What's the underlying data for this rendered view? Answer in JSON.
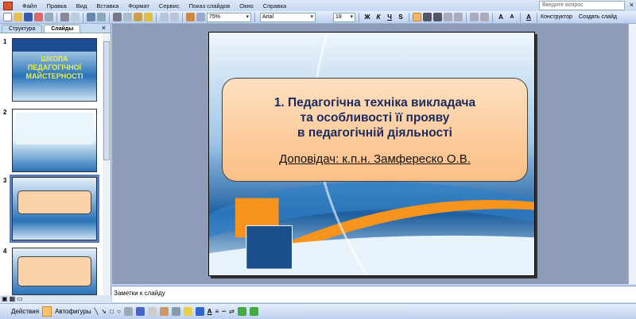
{
  "menu": [
    "Файл",
    "Правка",
    "Вид",
    "Вставка",
    "Формат",
    "Сервис",
    "Показ слайдов",
    "Окно",
    "Справка"
  ],
  "help_placeholder": "Введите вопрос",
  "toolbar": {
    "zoom": "75%",
    "font": "Arial",
    "size": "18",
    "bold": "Ж",
    "italic": "К",
    "underline": "Ч",
    "shadow": "S",
    "designer": "Конструктор",
    "new_slide": "Создать слайд"
  },
  "pane": {
    "tabs": [
      "Структура",
      "Слайды"
    ],
    "close": "×"
  },
  "thumbs": [
    {
      "num": "1",
      "title": "ШКОЛА ПЕДАГОГІЧНОЇ МАЙСТЕРНОСТІ"
    },
    {
      "num": "2"
    },
    {
      "num": "3"
    },
    {
      "num": "4"
    }
  ],
  "slide": {
    "title_lines": [
      "1. Педагогічна  техніка  викладача",
      "та  особливості  її  прояву",
      "в  педагогічній діяльності"
    ],
    "speaker": "Доповідач:   к.п.н. Замфереско О.В."
  },
  "notes_placeholder": "Заметки к слайду",
  "draw": {
    "actions": "Действия",
    "autoshapes": "Автофигуры"
  },
  "colors": {
    "accent": "#f7941d",
    "slide_blue": "#1e5fa0",
    "box": "#fcc896"
  }
}
